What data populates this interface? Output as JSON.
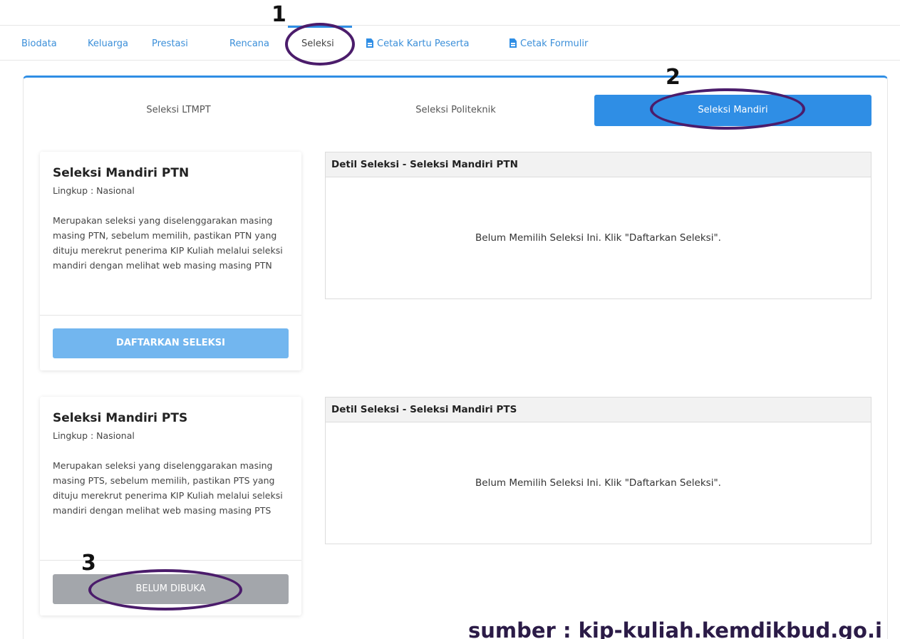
{
  "nav": {
    "tabs": [
      {
        "label": "Biodata"
      },
      {
        "label": "Keluarga"
      },
      {
        "label": "Prestasi"
      },
      {
        "label": "Rencana"
      },
      {
        "label": "Seleksi"
      },
      {
        "label": "Cetak Kartu Peserta"
      },
      {
        "label": "Cetak Formulir"
      }
    ],
    "active": "Seleksi"
  },
  "subtabs": [
    {
      "label": "Seleksi LTMPT"
    },
    {
      "label": "Seleksi Politeknik"
    },
    {
      "label": "Seleksi Mandiri"
    }
  ],
  "cards": [
    {
      "title": "Seleksi Mandiri PTN",
      "scope": "Lingkup : Nasional",
      "description": "Merupakan seleksi yang diselenggarakan masing masing PTN, sebelum memilih, pastikan PTN yang dituju merekrut penerima KIP Kuliah melalui seleksi mandiri dengan melihat web masing masing PTN",
      "button": "DAFTARKAN SELEKSI"
    },
    {
      "title": "Seleksi Mandiri PTS",
      "scope": "Lingkup : Nasional",
      "description": "Merupakan seleksi yang diselenggarakan masing masing PTS, sebelum memilih, pastikan PTS yang dituju merekrut penerima KIP Kuliah melalui seleksi mandiri dengan melihat web masing masing PTS",
      "button": "BELUM DIBUKA"
    }
  ],
  "details": [
    {
      "header": "Detil Seleksi - Seleksi Mandiri PTN",
      "message": "Belum Memilih Seleksi Ini. Klik \"Daftarkan Seleksi\"."
    },
    {
      "header": "Detil Seleksi - Seleksi Mandiri PTS",
      "message": "Belum Memilih Seleksi Ini. Klik \"Daftarkan Seleksi\"."
    }
  ],
  "annotations": {
    "one": "1",
    "two": "2",
    "three": "3"
  },
  "source": "sumber : kip-kuliah.kemdikbud.go.i",
  "colors": {
    "accent": "#2f8ee5",
    "annotation_ring": "#4b1c6b"
  }
}
